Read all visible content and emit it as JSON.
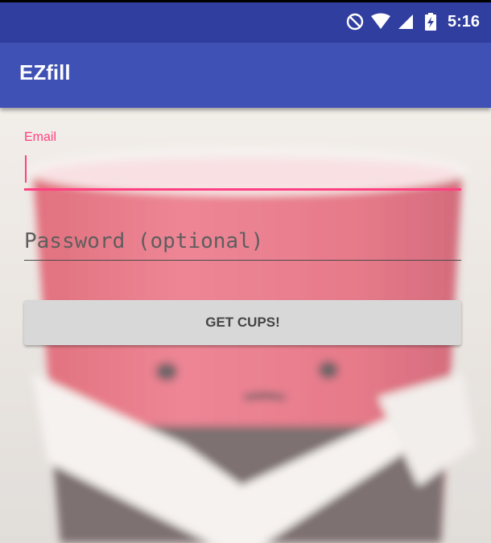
{
  "status_bar": {
    "time": "5:16",
    "icons": [
      "do-not-disturb-icon",
      "wifi-icon",
      "cell-signal-icon",
      "battery-charging-icon"
    ],
    "background": "#303f9f"
  },
  "app_bar": {
    "title": "EZfill",
    "background": "#3f51b5"
  },
  "form": {
    "email": {
      "label": "Email",
      "value": "",
      "accent": "#ff4081"
    },
    "password": {
      "placeholder": "Password (optional)",
      "value": ""
    },
    "submit_label": "GET CUPS!"
  },
  "background_image": {
    "subject": "red-party-cup-with-face"
  }
}
